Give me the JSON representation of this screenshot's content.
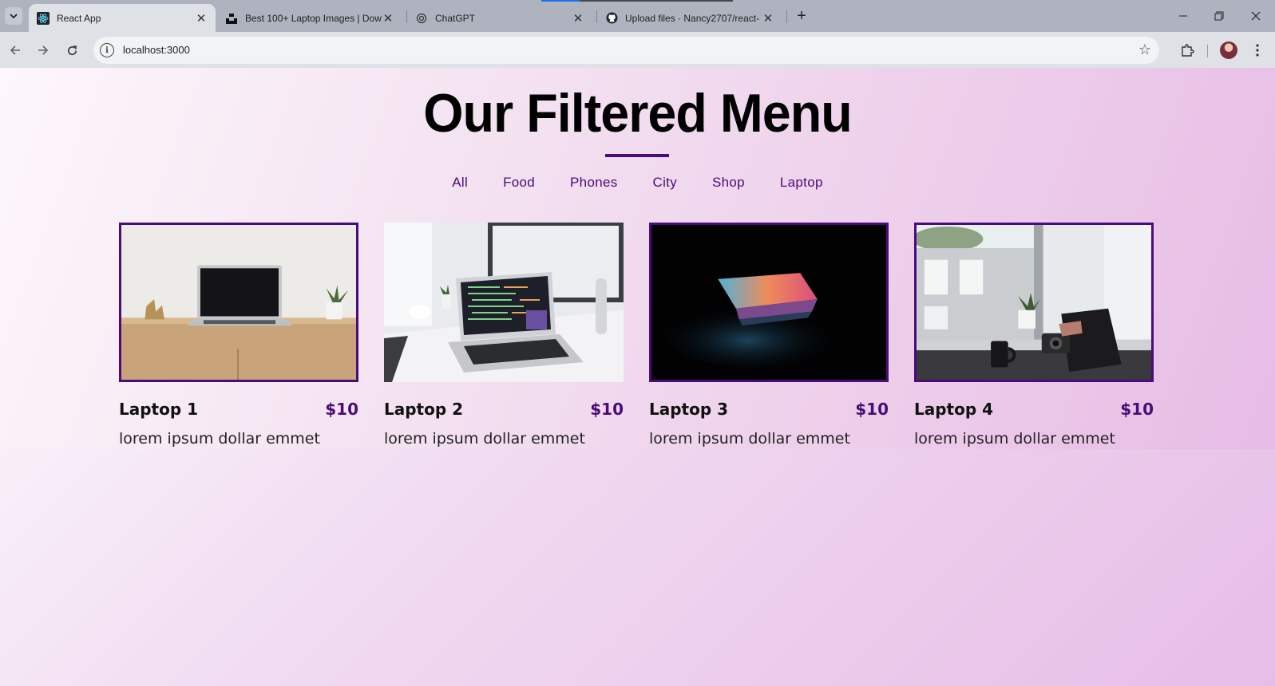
{
  "browser": {
    "tabs": [
      {
        "title": "React App",
        "icon": "react-icon",
        "active": true
      },
      {
        "title": "Best 100+ Laptop Images | Dow",
        "icon": "unsplash-icon",
        "active": false
      },
      {
        "title": "ChatGPT",
        "icon": "chatgpt-icon",
        "active": false
      },
      {
        "title": "Upload files · Nancy2707/react-",
        "icon": "github-icon",
        "active": false
      }
    ],
    "url": "localhost:3000"
  },
  "page": {
    "title": "Our Filtered Menu",
    "accent_color": "#4a0c7a",
    "filters": [
      "All",
      "Food",
      "Phones",
      "City",
      "Shop",
      "Laptop"
    ],
    "items": [
      {
        "name": "Laptop 1",
        "price": "$10",
        "desc": "lorem ipsum dollar emmet",
        "highlighted": true
      },
      {
        "name": "Laptop 2",
        "price": "$10",
        "desc": "lorem ipsum dollar emmet",
        "highlighted": false
      },
      {
        "name": "Laptop 3",
        "price": "$10",
        "desc": "lorem ipsum dollar emmet",
        "highlighted": true
      },
      {
        "name": "Laptop 4",
        "price": "$10",
        "desc": "lorem ipsum dollar emmet",
        "highlighted": true
      }
    ]
  }
}
